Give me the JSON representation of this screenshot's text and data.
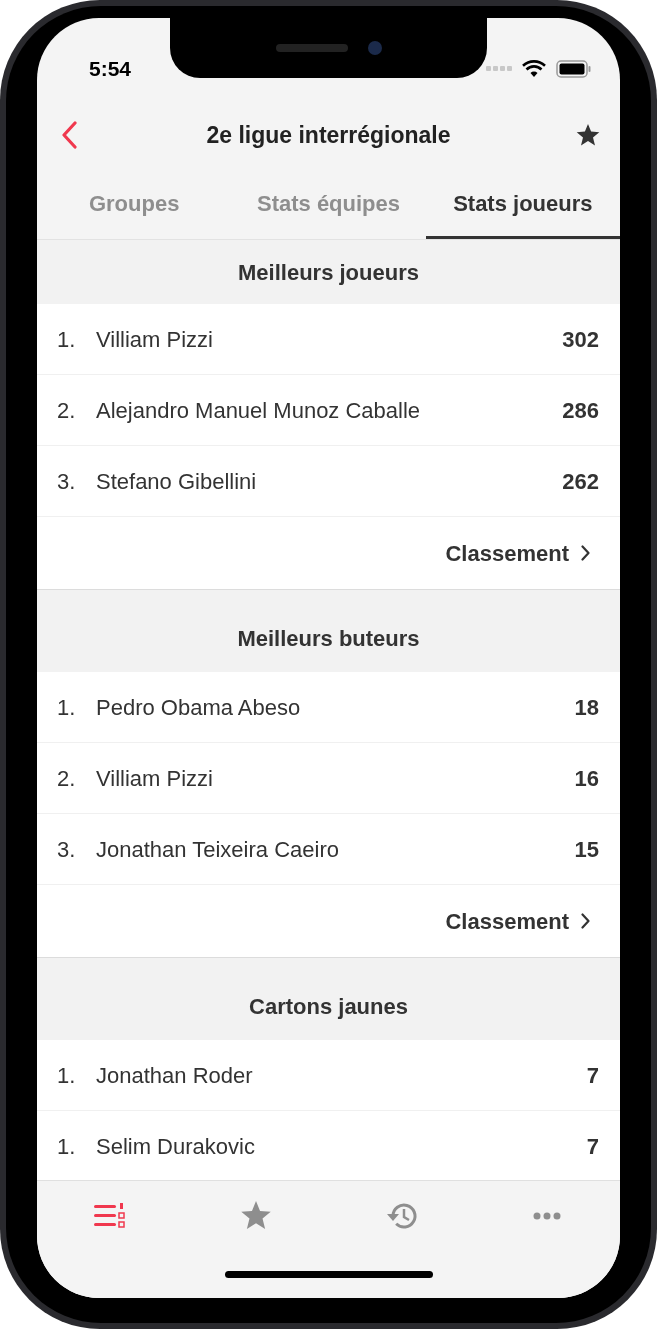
{
  "status_bar": {
    "time": "5:54"
  },
  "nav": {
    "title": "2e ligue interrégionale"
  },
  "tabs": [
    {
      "label": "Groupes",
      "selected": false
    },
    {
      "label": "Stats équipes",
      "selected": false
    },
    {
      "label": "Stats joueurs",
      "selected": true
    }
  ],
  "sections": [
    {
      "title": "Meilleurs joueurs",
      "rows": [
        {
          "rank": "1.",
          "name": "Villiam Pizzi",
          "value": "302"
        },
        {
          "rank": "2.",
          "name": "Alejandro Manuel Munoz Caballe",
          "value": "286"
        },
        {
          "rank": "3.",
          "name": "Stefano Gibellini",
          "value": "262"
        }
      ],
      "link": "Classement"
    },
    {
      "title": "Meilleurs buteurs",
      "rows": [
        {
          "rank": "1.",
          "name": "Pedro Obama Abeso",
          "value": "18"
        },
        {
          "rank": "2.",
          "name": "Villiam Pizzi",
          "value": "16"
        },
        {
          "rank": "3.",
          "name": "Jonathan Teixeira Caeiro",
          "value": "15"
        }
      ],
      "link": "Classement"
    },
    {
      "title": "Cartons jaunes",
      "rows": [
        {
          "rank": "1.",
          "name": "Jonathan Roder",
          "value": "7"
        },
        {
          "rank": "1.",
          "name": "Selim Durakovic",
          "value": "7"
        }
      ]
    }
  ],
  "tab_bar": [
    {
      "kind": "list",
      "selected": true
    },
    {
      "kind": "star",
      "selected": false
    },
    {
      "kind": "history",
      "selected": false
    },
    {
      "kind": "more",
      "selected": false
    }
  ]
}
